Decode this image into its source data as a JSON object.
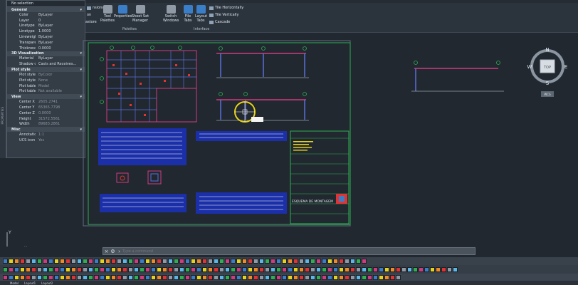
{
  "ribbon": {
    "buttons": [
      {
        "label": "Tool Palettes"
      },
      {
        "label": "Properties"
      },
      {
        "label": "Sheet Set Manager"
      },
      {
        "label": "Switch Windows"
      },
      {
        "label": "File Tabs"
      },
      {
        "label": "Layout Tabs"
      }
    ],
    "fragments": [
      "nsional",
      "on",
      "astore"
    ],
    "window_options": [
      "Tile Horizontally",
      "Tile Vertically",
      "Cascade"
    ],
    "panels": [
      "Palettes",
      "Interface"
    ]
  },
  "properties": {
    "selection": "No selection",
    "sections": [
      {
        "title": "General",
        "rows": [
          {
            "k": "Color",
            "v": "ByLayer"
          },
          {
            "k": "Layer",
            "v": "0"
          },
          {
            "k": "Linetype",
            "v": "ByLayer"
          },
          {
            "k": "Linetype scale",
            "v": "1.0000"
          },
          {
            "k": "Lineweight",
            "v": "ByLayer"
          },
          {
            "k": "Transparency",
            "v": "ByLayer"
          },
          {
            "k": "Thickness",
            "v": "0.0000"
          }
        ]
      },
      {
        "title": "3D Visualization",
        "rows": [
          {
            "k": "Material",
            "v": "ByLayer"
          },
          {
            "k": "Shadow display",
            "v": "Casts and Receives..."
          }
        ]
      },
      {
        "title": "Plot style",
        "rows": [
          {
            "k": "Plot style",
            "v": "ByColor"
          },
          {
            "k": "Plot style table",
            "v": "None"
          },
          {
            "k": "Plot table atta...",
            "v": "Model"
          },
          {
            "k": "Plot table type",
            "v": "Not available"
          }
        ]
      },
      {
        "title": "View",
        "rows": [
          {
            "k": "Center X",
            "v": "2605.2741"
          },
          {
            "k": "Center Y",
            "v": "65365.7798"
          },
          {
            "k": "Center Z",
            "v": "0.0000"
          },
          {
            "k": "Height",
            "v": "31572.5561"
          },
          {
            "k": "Width",
            "v": "89683.2861"
          }
        ]
      },
      {
        "title": "Misc",
        "rows": [
          {
            "k": "Annotation sc...",
            "v": "1:1"
          },
          {
            "k": "UCS icon On",
            "v": "Yes"
          }
        ]
      }
    ],
    "side_label": "PROPERTIES"
  },
  "drawing": {
    "title_block_text": "ESQUEMA DE MONTAGEM"
  },
  "viewcube": {
    "n": "N",
    "s": "S",
    "e": "E",
    "w": "W",
    "top": "TOP",
    "wcs": "WCS"
  },
  "ucs": {
    "x": "X",
    "y": "Y"
  },
  "command": {
    "placeholder": "Type a command"
  },
  "status": {
    "tabs": [
      "Model",
      "Layout1",
      "Layout2"
    ]
  }
}
